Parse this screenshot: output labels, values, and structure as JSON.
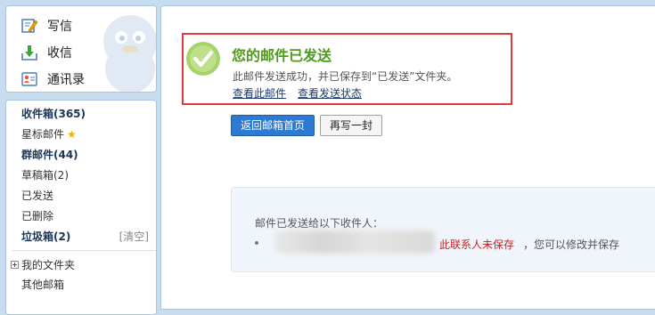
{
  "sidebar": {
    "top_items": [
      {
        "label": "写信",
        "icon": "pencil-icon"
      },
      {
        "label": "收信",
        "icon": "inbox-download-icon"
      },
      {
        "label": "通讯录",
        "icon": "contacts-icon"
      }
    ],
    "folders": {
      "inbox": "收件箱(365)",
      "starred": "星标邮件",
      "group": "群邮件(44)",
      "drafts": "草稿箱(2)",
      "sent": "已发送",
      "deleted": "已删除",
      "junk": "垃圾箱(2)",
      "junk_clear": "[清空]",
      "my_folders": "我的文件夹",
      "other_mailboxes": "其他邮箱"
    }
  },
  "main": {
    "title": "您的邮件已发送",
    "description": "此邮件发送成功，并已保存到“已发送”文件夹。",
    "link_view_mail": "查看此邮件",
    "link_view_status": "查看发送状态",
    "btn_back": "返回邮箱首页",
    "btn_rewrite": "再写一封",
    "recipients_heading": "邮件已发送给以下收件人：",
    "contact_unsaved": "此联系人未保存",
    "contact_note": "，您可以修改并保存"
  },
  "colors": {
    "success_green": "#4f9a1c",
    "highlight_red": "#e0393e",
    "primary_button": "#2c7ad1",
    "warning_red": "#cc1f1f"
  }
}
